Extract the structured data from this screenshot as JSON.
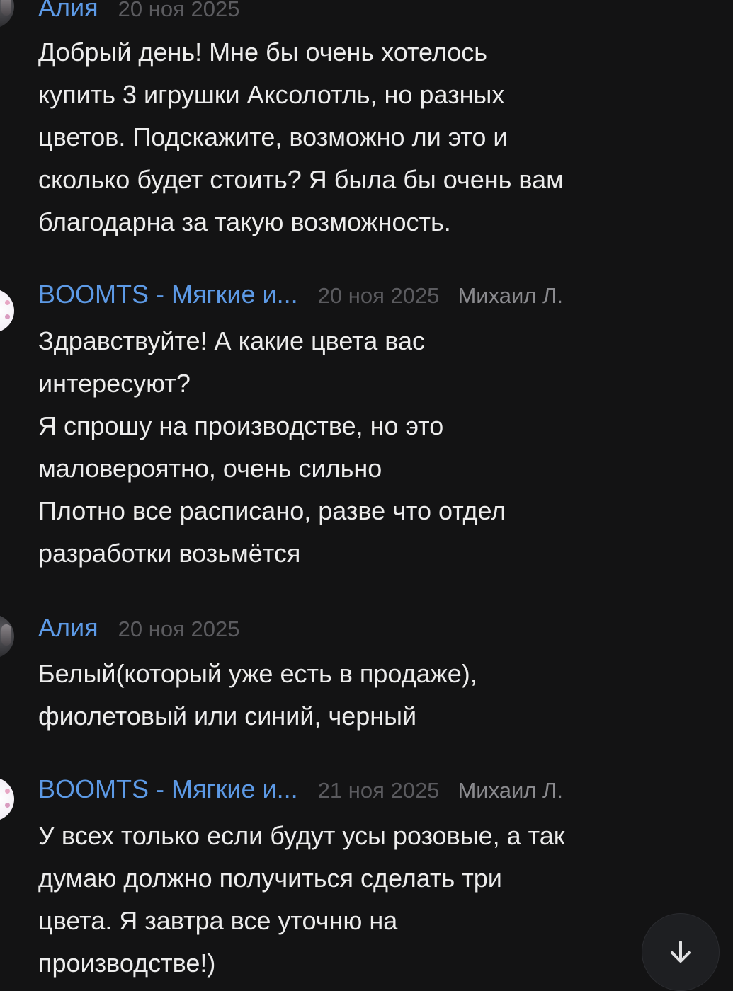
{
  "messages": [
    {
      "author": "Алия",
      "date": "20 ноя 2025",
      "text": "Добрый день! Мне бы очень хотелось\nкупить 3 игрушки Аксолотль, но разных\nцветов. Подскажите, возможно ли это и\nсколько будет стоить? Я была бы очень вам\nблагодарна за такую возможность."
    },
    {
      "author": "BOOMTS - Мягкие и...",
      "date": "20 ноя 2025",
      "operator": "Михаил Л.",
      "text": "Здравствуйте! А какие цвета вас\nинтересуют?\nЯ спрошу на производстве, но это\nмаловероятно, очень сильно\nПлотно все расписано, разве что отдел\nразработки возьмётся"
    },
    {
      "author": "Алия",
      "date": "20 ноя 2025",
      "text": "Белый(который уже есть в продаже),\nфиолетовый или синий, черный"
    },
    {
      "author": "BOOMTS - Мягкие и...",
      "date": "21 ноя 2025",
      "operator": "Михаил Л.",
      "text": "У всех только если будут усы розовые, а так\nдумаю должно получиться сделать три\nцвета. Я завтра все уточню на\nпроизводстве!)"
    }
  ],
  "scroll_button": {
    "icon": "arrow-down-icon"
  },
  "colors": {
    "background": "#131314",
    "author_name": "#5d9ae6",
    "date": "#5b5b5f",
    "operator": "#8a8a8e",
    "text": "#ececec"
  }
}
